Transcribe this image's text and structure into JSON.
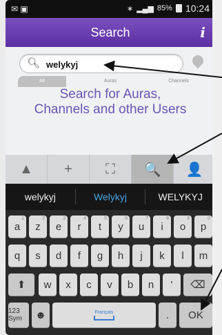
{
  "status_bar": {
    "battery_percent": "85%",
    "time": "10:24"
  },
  "header": {
    "title": "Search",
    "info_icon": "i"
  },
  "search": {
    "value": "welykyj",
    "placeholder": ""
  },
  "scope_tabs": [
    "All",
    "Auras",
    "Channels"
  ],
  "headline": {
    "line1": "Search for Auras,",
    "line2": "Channels and other Users"
  },
  "toolbar": {
    "items": [
      {
        "name": "home-icon",
        "glyph": "▲",
        "active": false
      },
      {
        "name": "add-icon",
        "glyph": "+",
        "active": false
      },
      {
        "name": "scan-icon",
        "glyph": "⛶",
        "active": false
      },
      {
        "name": "search-icon",
        "glyph": "🔍",
        "active": true
      },
      {
        "name": "profile-icon",
        "glyph": "👤",
        "active": false
      }
    ]
  },
  "suggestions": [
    "welykyj",
    "Welykyj",
    "WELYKYJ"
  ],
  "keyboard": {
    "row1": [
      "a",
      "z",
      "e",
      "r",
      "t",
      "y",
      "u",
      "i",
      "o",
      "p"
    ],
    "row1_nums": [
      "1",
      "2",
      "3",
      "4",
      "5",
      "6",
      "7",
      "8",
      "9",
      "0"
    ],
    "row2": [
      "q",
      "s",
      "d",
      "f",
      "g",
      "h",
      "j",
      "k",
      "l",
      "m"
    ],
    "row3": [
      "w",
      "x",
      "c",
      "v",
      "b",
      "n",
      "'"
    ],
    "sym_label": "123\nSym",
    "space_label": "Français",
    "period": ".",
    "ok_label": "OK",
    "shift_glyph": "⬆",
    "backspace_glyph": "⌫",
    "emoji_glyph": "☻"
  },
  "colors": {
    "accent": "#6a44b7",
    "suggestion_active": "#4aa3e0"
  }
}
